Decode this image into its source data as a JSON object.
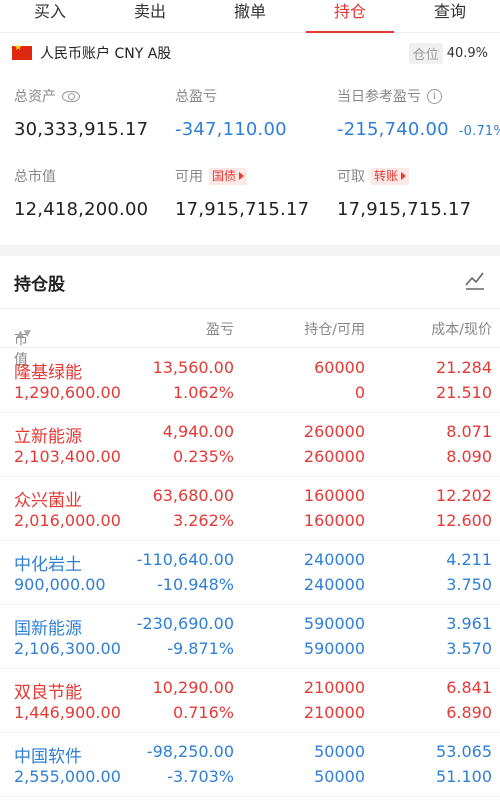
{
  "tabs": [
    "买入",
    "卖出",
    "撤单",
    "持仓",
    "查询"
  ],
  "active_tab": 3,
  "account": {
    "label": "人民币账户 CNY A股",
    "position_label": "仓位",
    "position_value": "40.9%"
  },
  "summary": {
    "total_assets_label": "总资产",
    "total_assets": "30,333,915.17",
    "total_pnl_label": "总盈亏",
    "total_pnl": "-347,110.00",
    "daily_pnl_label": "当日参考盈亏",
    "daily_pnl": "-215,740.00",
    "daily_pnl_pct": "-0.71%",
    "market_value_label": "总市值",
    "market_value": "12,418,200.00",
    "available_label": "可用",
    "available_tag": "国债",
    "available": "17,915,715.17",
    "withdrawable_label": "可取",
    "withdrawable_tag": "转账",
    "withdrawable": "17,915,715.17"
  },
  "holdings": {
    "title": "持仓股",
    "headers": {
      "market_value": "市值",
      "pnl": "盈亏",
      "position": "持仓/可用",
      "cost": "成本/现价"
    },
    "rows": [
      {
        "name": "隆基绿能",
        "market_value": "1,290,600.00",
        "pnl": "13,560.00",
        "pnl_pct": "1.062%",
        "position": "60000",
        "available": "0",
        "cost": "21.284",
        "price": "21.510",
        "color": "red"
      },
      {
        "name": "立新能源",
        "market_value": "2,103,400.00",
        "pnl": "4,940.00",
        "pnl_pct": "0.235%",
        "position": "260000",
        "available": "260000",
        "cost": "8.071",
        "price": "8.090",
        "color": "red"
      },
      {
        "name": "众兴菌业",
        "market_value": "2,016,000.00",
        "pnl": "63,680.00",
        "pnl_pct": "3.262%",
        "position": "160000",
        "available": "160000",
        "cost": "12.202",
        "price": "12.600",
        "color": "red"
      },
      {
        "name": "中化岩土",
        "market_value": "900,000.00",
        "pnl": "-110,640.00",
        "pnl_pct": "-10.948%",
        "position": "240000",
        "available": "240000",
        "cost": "4.211",
        "price": "3.750",
        "color": "blue"
      },
      {
        "name": "国新能源",
        "market_value": "2,106,300.00",
        "pnl": "-230,690.00",
        "pnl_pct": "-9.871%",
        "position": "590000",
        "available": "590000",
        "cost": "3.961",
        "price": "3.570",
        "color": "blue"
      },
      {
        "name": "双良节能",
        "market_value": "1,446,900.00",
        "pnl": "10,290.00",
        "pnl_pct": "0.716%",
        "position": "210000",
        "available": "210000",
        "cost": "6.841",
        "price": "6.890",
        "color": "red"
      },
      {
        "name": "中国软件",
        "market_value": "2,555,000.00",
        "pnl": "-98,250.00",
        "pnl_pct": "-3.703%",
        "position": "50000",
        "available": "50000",
        "cost": "53.065",
        "price": "51.100",
        "color": "blue"
      }
    ]
  },
  "colors": {
    "up": "#e53935",
    "down": "#2f7fd6"
  }
}
